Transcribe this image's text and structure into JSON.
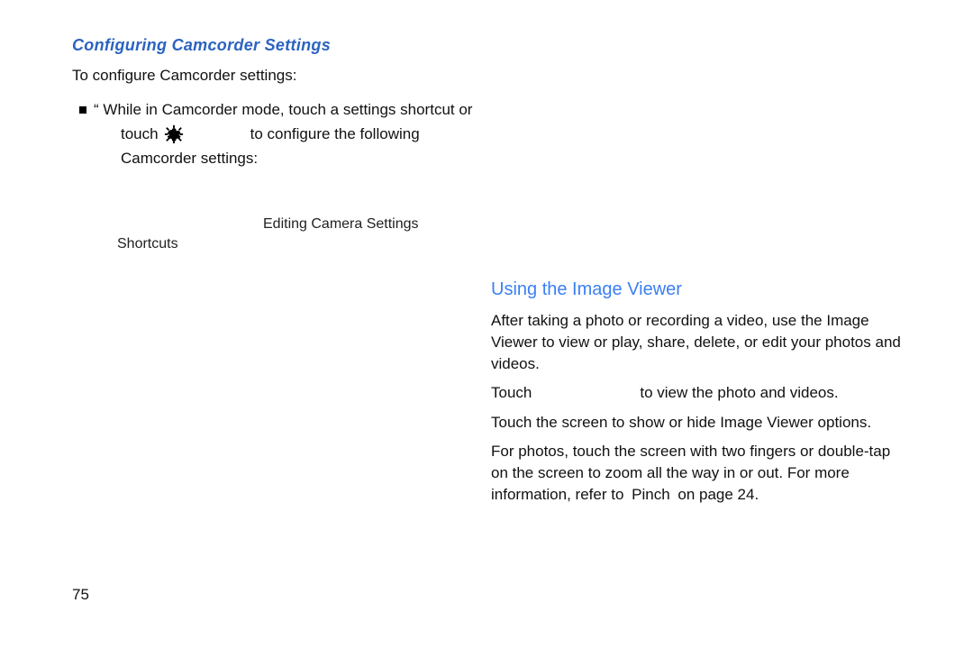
{
  "left": {
    "section_title": "Configuring Camcorder Settings",
    "intro_line": "To configure Camcorder settings:",
    "bullet": {
      "quote": "“",
      "line1": " While in Camcorder mode, touch a settings shortcut or",
      "touch_word": "touch",
      "after_icon": "to configure the following",
      "line3": "Camcorder settings:"
    },
    "sub": {
      "editing_label": "Editing Camera Settings",
      "shortcuts_label": "Shortcuts"
    },
    "icon_name": "gear-icon"
  },
  "right": {
    "section_title": "Using the Image Viewer",
    "para_intro": "After taking a photo or recording a video, use the Image Viewer to view or play, share, delete, or edit your photos and videos.",
    "touch_word": "Touch",
    "touch_rest": "to view the photo and videos.",
    "para3": "Touch the screen to show or hide Image Viewer options.",
    "para4": "For photos, touch the screen with two fingers or double-tap on the screen to zoom all the way in or out. For more information, refer to ",
    "pinch_label": "Pinch",
    "pinch_rest": " on page 24."
  },
  "page_number": "75"
}
